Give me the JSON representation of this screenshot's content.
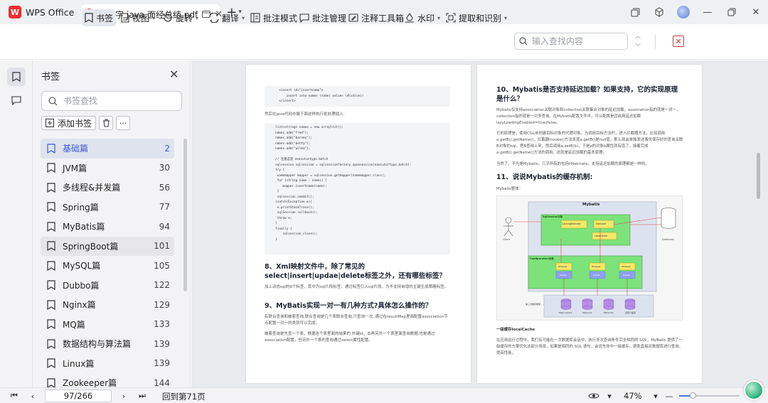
{
  "app": {
    "name": "WPS Office"
  },
  "tab": {
    "title": "12万字 java 面经总结.pdf"
  },
  "toolbar": {
    "bookmark": "书签",
    "view": "视图",
    "rotate": "旋转",
    "translate": "翻译",
    "annotation_mode": "批注模式",
    "annotation_manage": "批注管理",
    "annotation_tools": "注释工具箱",
    "watermark": "水印",
    "extract": "提取和识别",
    "search_placeholder": "输入查找内容"
  },
  "panel": {
    "title": "书签",
    "search_placeholder": "书签查找",
    "add_bookmark": "添加书签",
    "items": [
      {
        "label": "基础篇",
        "page": "2"
      },
      {
        "label": "JVM篇",
        "page": "30"
      },
      {
        "label": "多线程&并发篇",
        "page": "56"
      },
      {
        "label": "Spring篇",
        "page": "77"
      },
      {
        "label": "MyBatis篇",
        "page": "94"
      },
      {
        "label": "SpringBoot篇",
        "page": "101"
      },
      {
        "label": "MySQL篇",
        "page": "105"
      },
      {
        "label": "Dubbo篇",
        "page": "122"
      },
      {
        "label": "Nginx篇",
        "page": "129"
      },
      {
        "label": "MQ篇",
        "page": "133"
      },
      {
        "label": "数据结构与算法篇",
        "page": "139"
      },
      {
        "label": "Linux篇",
        "page": "139"
      },
      {
        "label": "Zookeeper篇",
        "page": "144"
      }
    ]
  },
  "page_left": {
    "code1": "    <insert id=\"insertname\">\n        insert into names (name) values (#{value})\n    </insert>",
    "text1": "然后在java代码中像下面这样执行批处理插入:",
    "code2": "  list<string> names = new arraylist();\n  names.add(\"fred\");\n  names.add(\"barney\");\n  names.add(\"betty\");\n  names.add(\"wilma\");\n\n  // 注意这里 executortype.batch\n  sqlsession sqlsession = sqlsessionfactory.opensession(executortype.batch);\n  try {\n   namemapper mapper = sqlsession.getmapper(namemapper.class);\n   for (string name : names) {\n      mapper.insertname(name);\n   }\n   sqlsession.commit();\n  }catch(Exception e){\n   e.printStackTrace();\n   sqlSession.rollback();\n   throw e;\n  }\n  finally {\n      sqlsession.close();\n  }",
    "h8": "8、Xml映射文件中，除了常见的select|insert|updae|delete标签之外，还有哪些标签？",
    "p8": "加上动态sql的9个标签，其中为sql片段标签，通过标签引入sql片段，为不支持自增的主键生成策略标签。",
    "h9": "9、MyBatis实现一对一有几种方式?具体怎么操作的？",
    "p9a": "有联合查询和嵌套查询,联合查询是几个表联合查询,只查询一次, 通过在resultMap里面配置association节点配置一对一的类就可以完成；",
    "p9b": "嵌套查询是先查一个表，根据这个表里面的结果的 外键id，去再另外一个表里面查询数据,也是通过association配置，但另外一个表的查询通过select属性配置。"
  },
  "page_right": {
    "h10": "10、Mybatis是否支持延迟加载？如果支持，它的实现原理是什么？",
    "p10a": "Mybatis仅支持association关联对象和collection关联集合对象的延迟加载，association指的就是一对一，collection指的就是一对多查询。在Mybatis配置文件中，可以配置是否启用延迟加载lazyLoadingEnabled=true|false。",
    "p10b": "它的原理是，使用CGLIB创建目标对象的代理对象，当调用目标方法时，进入拦截器方法，比如调用a.getB().getName()，拦截器invoke()方法发现a.getB()是null值，那么就会单独发送事先保存好的查询关联B对象的sql，把B查询上来，然后调用a.setB(b)，于是a的对象b属性就有值了，接着完成a.getB().getName()方法的调用。这就是延迟加载的基本原理。",
    "p10c": "当然了，不光是Mybatis，几乎所有的包括Hibernate，支持延迟加载的原理都是一样的。",
    "h11": "11、说说Mybatis的缓存机制:",
    "p11": "Mybatis整体：",
    "diagram": {
      "title": "Mybatis",
      "client": "Client",
      "database": "Database",
      "session": "SqlSession对象",
      "executor": "CachingExecutor",
      "executor2": "Executor",
      "local": "LocalCache",
      "config": "Configuration对象",
      "wrapper": "Wrapper",
      "cache": "Cache",
      "third": "第三方缓存框架",
      "c1": "Memcached",
      "c2": "OSCache",
      "c3": "EHCache",
      "c4": "自定义缓存"
    },
    "first_cache_title": "一级缓存localCache",
    "first_cache_text": "在应用运行过程中，我们有可能在一次数据库会话中，执行多次查询条件完全相同的 SQL，MyBatis 提供了一级缓存的方案优化这部分场景，如果是相同的 SQL 语句，会优先命中一级缓存，避免直接对数据库进行查询，提高性能。"
  },
  "status": {
    "page_indicator": "97/266",
    "goto_text": "回到第71页",
    "zoom": "47%",
    "zoom_level": 0.22
  }
}
